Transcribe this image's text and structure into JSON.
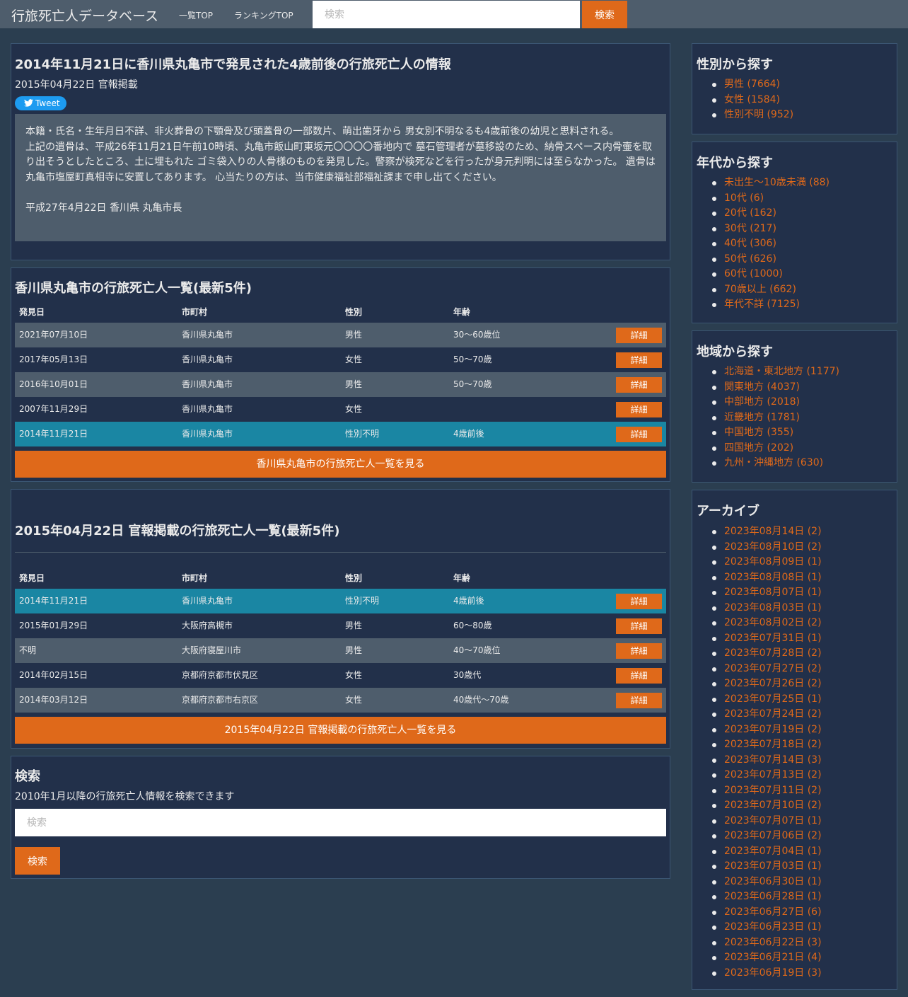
{
  "navbar": {
    "brand": "行旅死亡人データベース",
    "links": [
      "一覧TOP",
      "ランキングTOP"
    ],
    "search_placeholder": "検索",
    "search_button": "検索"
  },
  "detail": {
    "title": "2014年11月21日に香川県丸亀市で発見された4歳前後の行旅死亡人の情報",
    "meta": "2015年04月22日 官報掲載",
    "tweet": "Tweet",
    "body_line1": "本籍・氏名・生年月日不詳、非火葬骨の下顎骨及び頭蓋骨の一部数片、萌出歯牙から 男女別不明なるも4歳前後の幼児と思料される。",
    "body_line2": "上記の遺骨は、平成26年11月21日午前10時頃、丸亀市飯山町東坂元〇〇〇〇番地内で 墓石管理者が墓移設のため、納骨スペース内骨壷を取り出そうとしたところ、土に埋もれた ゴミ袋入りの人骨様のものを発見した。警察が検死などを行ったが身元判明には至らなかった。 遺骨は丸亀市塩屋町真相寺に安置してあります。 心当たりの方は、当市健康福祉部福祉課まで申し出てください。",
    "signature": "平成27年4月22日 香川県 丸亀市長"
  },
  "city_list": {
    "title": "香川県丸亀市の行旅死亡人一覧(最新5件)",
    "headers": [
      "発見日",
      "市町村",
      "性別",
      "年齢"
    ],
    "rows": [
      [
        "2021年07月10日",
        "香川県丸亀市",
        "男性",
        "30～60歳位",
        "詳細"
      ],
      [
        "2017年05月13日",
        "香川県丸亀市",
        "女性",
        "50～70歳",
        "詳細"
      ],
      [
        "2016年10月01日",
        "香川県丸亀市",
        "男性",
        "50～70歳",
        "詳細"
      ],
      [
        "2007年11月29日",
        "香川県丸亀市",
        "女性",
        "",
        "詳細"
      ],
      [
        "2014年11月21日",
        "香川県丸亀市",
        "性別不明",
        "4歳前後",
        "詳細"
      ]
    ],
    "more_button": "香川県丸亀市の行旅死亡人一覧を見る"
  },
  "date_list": {
    "title": "2015年04月22日 官報掲載の行旅死亡人一覧(最新5件)",
    "headers": [
      "発見日",
      "市町村",
      "性別",
      "年齢"
    ],
    "rows": [
      [
        "2014年11月21日",
        "香川県丸亀市",
        "性別不明",
        "4歳前後",
        "詳細"
      ],
      [
        "2015年01月29日",
        "大阪府高槻市",
        "男性",
        "60～80歳",
        "詳細"
      ],
      [
        "不明",
        "大阪府寝屋川市",
        "男性",
        "40～70歳位",
        "詳細"
      ],
      [
        "2014年02月15日",
        "京都府京都市伏見区",
        "女性",
        "30歳代",
        "詳細"
      ],
      [
        "2014年03月12日",
        "京都府京都市右京区",
        "女性",
        "40歳代～70歳",
        "詳細"
      ]
    ],
    "more_button": "2015年04月22日 官報掲載の行旅死亡人一覧を見る"
  },
  "search": {
    "title": "検索",
    "description": "2010年1月以降の行旅死亡人情報を検索できます",
    "placeholder": "検索",
    "button": "検索"
  },
  "sidebar": {
    "gender": {
      "title": "性別から探す",
      "items": [
        "男性 (7664)",
        "女性 (1584)",
        "性別不明 (952)"
      ]
    },
    "age": {
      "title": "年代から探す",
      "items": [
        "未出生～10歳未満 (88)",
        "10代 (6)",
        "20代 (162)",
        "30代 (217)",
        "40代 (306)",
        "50代 (626)",
        "60代 (1000)",
        "70歳以上 (662)",
        "年代不詳 (7125)"
      ]
    },
    "region": {
      "title": "地域から探す",
      "items": [
        "北海道・東北地方 (1177)",
        "関東地方 (4037)",
        "中部地方 (2018)",
        "近畿地方 (1781)",
        "中国地方 (355)",
        "四国地方 (202)",
        "九州・沖縄地方 (630)"
      ]
    },
    "archive": {
      "title": "アーカイブ",
      "items": [
        "2023年08月14日 (2)",
        "2023年08月10日 (2)",
        "2023年08月09日 (1)",
        "2023年08月08日 (1)",
        "2023年08月07日 (1)",
        "2023年08月03日 (1)",
        "2023年08月02日 (2)",
        "2023年07月31日 (1)",
        "2023年07月28日 (2)",
        "2023年07月27日 (2)",
        "2023年07月26日 (2)",
        "2023年07月25日 (1)",
        "2023年07月24日 (2)",
        "2023年07月19日 (2)",
        "2023年07月18日 (2)",
        "2023年07月14日 (3)",
        "2023年07月13日 (2)",
        "2023年07月11日 (2)",
        "2023年07月10日 (2)",
        "2023年07月07日 (1)",
        "2023年07月06日 (2)",
        "2023年07月04日 (1)",
        "2023年07月03日 (1)",
        "2023年06月30日 (1)",
        "2023年06月28日 (1)",
        "2023年06月27日 (6)",
        "2023年06月23日 (1)",
        "2023年06月22日 (3)",
        "2023年06月21日 (4)",
        "2023年06月19日 (3)"
      ]
    }
  },
  "colors": {
    "background": "#2b3e50",
    "panel": "#22304a",
    "navbar": "#4e5d6c",
    "accent": "#df691a",
    "highlight_row": "#1a86a3"
  }
}
